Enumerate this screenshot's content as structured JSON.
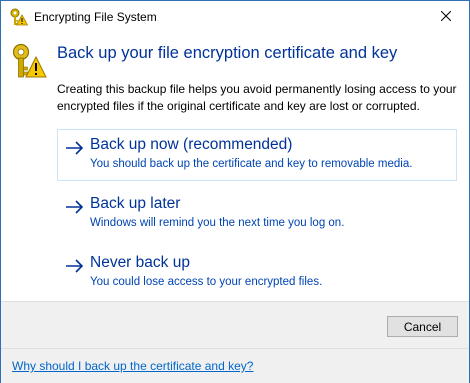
{
  "window": {
    "title": "Encrypting File System"
  },
  "content": {
    "heading": "Back up your file encryption certificate and key",
    "description": "Creating this backup file helps you avoid permanently losing access to your encrypted files if the original certificate and key are lost or corrupted."
  },
  "options": [
    {
      "title": "Back up now (recommended)",
      "subtitle": "You should back up the certificate and key to removable media."
    },
    {
      "title": "Back up later",
      "subtitle": "Windows will remind you the next time you log on."
    },
    {
      "title": "Never back up",
      "subtitle": "You could lose access to your encrypted files."
    }
  ],
  "footer": {
    "cancel_label": "Cancel",
    "help_link": "Why should I back up the certificate and key?"
  },
  "colors": {
    "accent": "#003399",
    "link": "#0066cc",
    "border": "#2f6fb5"
  },
  "icons": {
    "title": "key-warning-icon",
    "main": "key-warning-icon",
    "option": "arrow-right-icon",
    "close": "close-icon"
  }
}
